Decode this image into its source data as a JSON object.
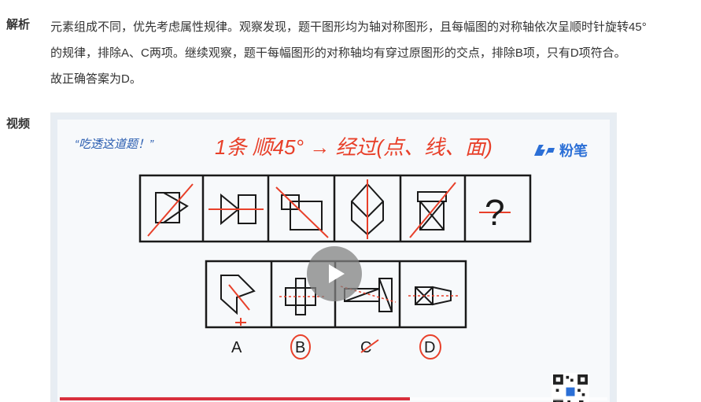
{
  "analysis": {
    "label": "解析",
    "lines": [
      "元素组成不同，优先考虑属性规律。观察发现，题干图形均为轴对称图形，且每幅图的对称轴依次呈顺时针旋转45°",
      "的规律，排除A、C两项。继续观察，题干每幅图形的对称轴均有穿过原图形的交点，排除B项，只有D项符合。",
      "故正确答案为D。"
    ]
  },
  "video": {
    "label": "视频",
    "handwritten_title": "“吃透这道题！”",
    "handwritten_note": "1条 顺45° → 经过(点、线、面)",
    "brand": "粉笔",
    "question_mark": "?",
    "options": [
      "A",
      "B",
      "C",
      "D"
    ],
    "progress": 0.64,
    "colors": {
      "accent_red": "#d9303d",
      "ink_red": "#e8402a",
      "brand_blue": "#2b6fd6",
      "ink_blue": "#2a5db0"
    }
  }
}
